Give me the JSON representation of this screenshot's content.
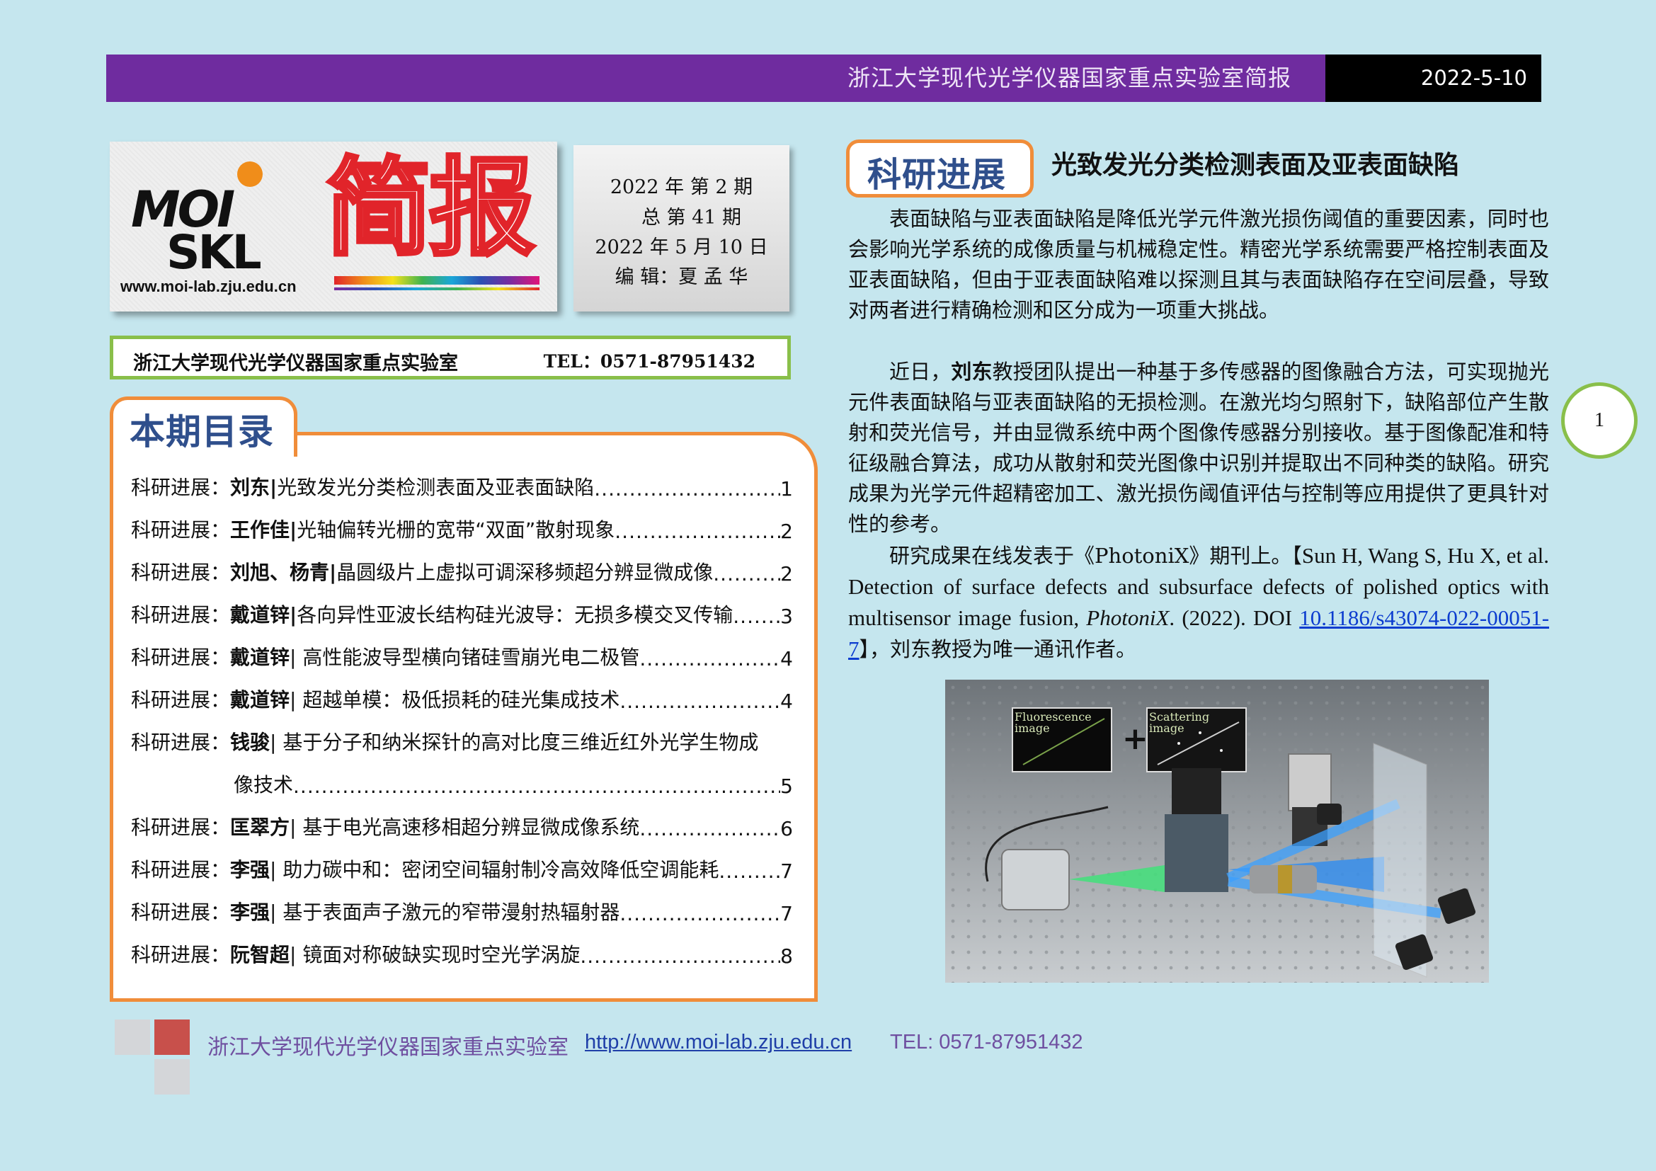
{
  "header": {
    "title": "浙江大学现代光学仪器国家重点实验室简报",
    "date": "2022-5-10"
  },
  "logo": {
    "moi": "MOI",
    "skl": "SKL",
    "jianbao": "简报",
    "url": "www.moi-lab.zju.edu.cn",
    "colors": {
      "accent": "#e1242a",
      "dot": "#f08d1a"
    }
  },
  "issue": {
    "line1": "2022 年 第 2 期",
    "line2": "总 第 41 期",
    "line3": "2022 年 5 月 10 日",
    "line4": "编 辑：夏 孟 华"
  },
  "lab_band": {
    "name": "浙江大学现代光学仪器国家重点实验室",
    "tel": "TEL：0571-87951432"
  },
  "toc": {
    "title": "本期目录",
    "items": [
      {
        "prefix": "科研进展：",
        "author": "刘东|",
        "title": " 光致发光分类检测表面及亚表面缺陷",
        "page": "1"
      },
      {
        "prefix": "科研进展：",
        "author": "王作佳|",
        "title": " 光轴偏转光栅的宽带“双面”散射现象",
        "page": "2"
      },
      {
        "prefix": "科研进展：",
        "author": "刘旭、杨青|",
        "title": " 晶圆级片上虚拟可调深移频超分辨显微成像",
        "page": "2"
      },
      {
        "prefix": "科研进展：",
        "author": "戴道锌|",
        "title": " 各向异性亚波长结构硅光波导：无损多模交叉传输",
        "page": "3"
      },
      {
        "prefix": "科研进展：",
        "author": "戴道锌",
        "title": "| 高性能波导型横向锗硅雪崩光电二极管",
        "page": "4"
      },
      {
        "prefix": "科研进展：",
        "author": "戴道锌",
        "title": "| 超越单模：极低损耗的硅光集成技术",
        "page": "4"
      },
      {
        "prefix": "科研进展：",
        "author": "钱骏",
        "title": "| 基于分子和纳米探针的高对比度三维近红外光学生物成",
        "page": ""
      },
      {
        "prefix": "",
        "author": "",
        "title": "像技术",
        "page": "5"
      },
      {
        "prefix": "科研进展：",
        "author": "匡翠方",
        "title": "| 基于电光高速移相超分辨显微成像系统",
        "page": "6"
      },
      {
        "prefix": "科研进展：",
        "author": " 李强",
        "title": "| 助力碳中和：密闭空间辐射制冷高效降低空调能耗",
        "page": "7"
      },
      {
        "prefix": "科研进展：",
        "author": " 李强",
        "title": "| 基于表面声子激元的窄带漫射热辐射器",
        "page": "7"
      },
      {
        "prefix": "科研进展：",
        "author": "阮智超",
        "title": "| 镜面对称破缺实现时空光学涡旋",
        "page": "8"
      }
    ]
  },
  "article": {
    "section": "科研进展",
    "title": "光致发光分类检测表面及亚表面缺陷",
    "p1": "表面缺陷与亚表面缺陷是降低光学元件激光损伤阈值的重要因素，同时也会影响光学系统的成像质量与机械稳定性。精密光学系统需要严格控制表面及亚表面缺陷，但由于亚表面缺陷难以探测且其与表面缺陷存在空间层叠，导致对两者进行精确检测和区分成为一项重大挑战。",
    "p2_a": "近日，",
    "p2_name": "刘东",
    "p2_b": "教授团队提出一种基于多传感器的图像融合方法，可实现抛光元件表面缺陷与亚表面缺陷的无损检测。在激光均匀照射下，缺陷部位产生散射和荧光信号，并由显微系统中两个图像传感器分别接收。基于图像配准和特征级融合算法，成功从散射和荧光图像中识别并提取出不同种类的缺陷。研究成果为光学元件超精密加工、激光损伤阈值评估与控制等应用提供了更具针对性的参考。",
    "p3_a": "研究成果在线发表于《PhotoniX》期刊上。【",
    "p3_ref": "Sun H, Wang S, Hu X, et al. Detection of surface defects and subsurface defects of polished optics with multisensor image fusion, ",
    "p3_journal": "PhotoniX",
    "p3_ref2": ". (2022). DOI ",
    "p3_doi": "10.1186/s43074-022-00051-7",
    "p3_b": "】，刘东教授为唯一通讯作者。",
    "figure": {
      "label_fluorescence": "Fluorescence image",
      "label_scattering": "Scattering image",
      "plus": "+"
    }
  },
  "page_number": "1",
  "footer": {
    "name": "浙江大学现代光学仪器国家重点实验室",
    "url": "http://www.moi-lab.zju.edu.cn",
    "tel": "TEL: 0571-87951432"
  }
}
